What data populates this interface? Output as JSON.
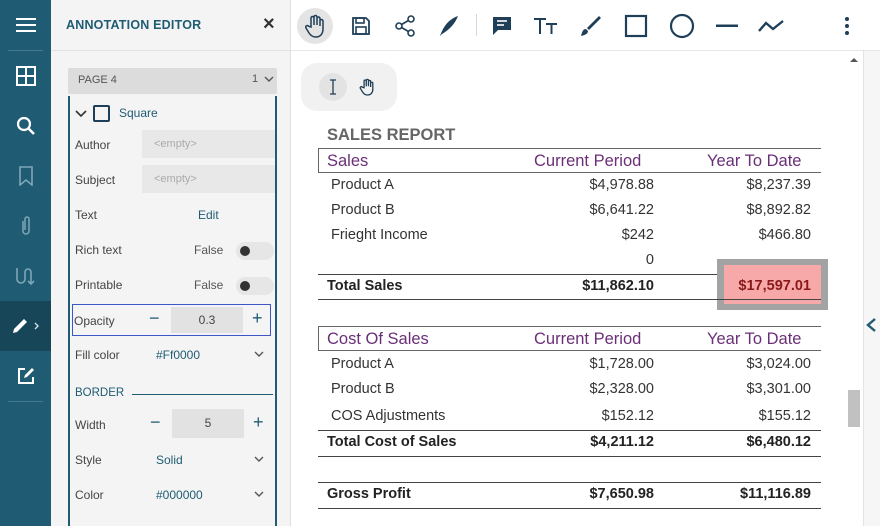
{
  "sidebar": {
    "icons": [
      "menu-icon",
      "thumbnails-icon",
      "search-icon",
      "bookmark-icon",
      "attachment-icon",
      "signature-icon",
      "annotation-editor-icon",
      "form-editor-icon"
    ]
  },
  "panel": {
    "title": "ANNOTATION EDITOR",
    "close_label": "×",
    "page_label": "PAGE 4",
    "page_count": "1",
    "annotation_type": "Square",
    "properties": {
      "author_label": "Author",
      "author_placeholder": "<empty>",
      "subject_label": "Subject",
      "subject_placeholder": "<empty>",
      "text_label": "Text",
      "text_value": "Edit",
      "rich_text_label": "Rich text",
      "rich_text_value": "False",
      "printable_label": "Printable",
      "printable_value": "False",
      "opacity_label": "Opacity",
      "opacity_value": "0.3",
      "fill_color_label": "Fill color",
      "fill_color_value": "#Ff0000"
    },
    "border": {
      "section_label": "BORDER",
      "width_label": "Width",
      "width_value": "5",
      "style_label": "Style",
      "style_value": "Solid",
      "color_label": "Color",
      "color_value": "#000000"
    },
    "minus": "−",
    "plus": "+"
  },
  "toolbar": {
    "tools": [
      "pan-icon",
      "save-icon",
      "share-icon",
      "pen-nib-icon",
      "comment-icon",
      "text-icon",
      "ink-icon",
      "square-icon",
      "circle-icon",
      "line-icon",
      "polyline-icon",
      "more-icon"
    ]
  },
  "report": {
    "title": "SALES REPORT",
    "sales_header": {
      "label": "Sales",
      "current": "Current Period",
      "ytd": "Year To Date"
    },
    "sales_rows": [
      {
        "name": "Product A",
        "current": "$4,978.88",
        "ytd": "$8,237.39"
      },
      {
        "name": "Product B",
        "current": "$6,641.22",
        "ytd": "$8,892.82"
      },
      {
        "name": "Frieght Income",
        "current": "$242",
        "ytd": "$466.80"
      },
      {
        "name": "",
        "current": "0",
        "ytd": ""
      }
    ],
    "total_sales": {
      "name": "Total Sales",
      "current": "$11,862.10",
      "ytd": "$17,597.01"
    },
    "cos_header": {
      "label": "Cost Of Sales",
      "current": "Current Period",
      "ytd": "Year To Date"
    },
    "cos_rows": [
      {
        "name": "Product A",
        "current": "$1,728.00",
        "ytd": "$3,024.00"
      },
      {
        "name": "Product B",
        "current": "$2,328.00",
        "ytd": "$3,301.00"
      },
      {
        "name": "COS Adjustments",
        "current": "$152.12",
        "ytd": "$155.12"
      }
    ],
    "total_cos": {
      "name": "Total Cost of Sales",
      "current": "$4,211.12",
      "ytd": "$6,480.12"
    },
    "gross_profit": {
      "name": "Gross Profit",
      "current": "$7,650.98",
      "ytd": "$11,116.89"
    }
  }
}
